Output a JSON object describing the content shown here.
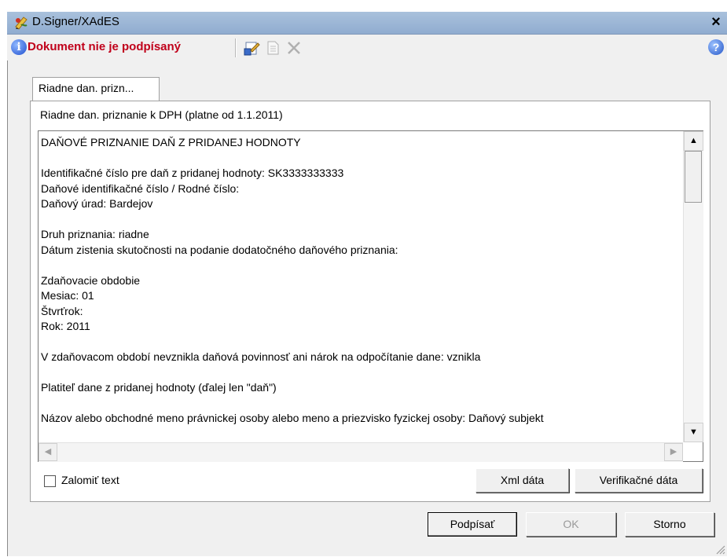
{
  "window": {
    "title": "D.Signer/XAdES",
    "close_label": "×"
  },
  "toolbar": {
    "status_text": "Dokument nie je podpísaný",
    "icons": [
      "info-icon",
      "sign-document-icon",
      "document-icon",
      "delete-icon",
      "help-icon"
    ]
  },
  "tab": {
    "label": "Riadne dan. prizn..."
  },
  "document": {
    "title": "Riadne dan. priznanie k DPH (platne od 1.1.2011)",
    "lines": [
      "DAŇOVÉ PRIZNANIE DAŇ Z PRIDANEJ HODNOTY",
      "",
      "Identifikačné číslo pre daň z pridanej hodnoty: SK3333333333",
      "Daňové identifikačné číslo / Rodné číslo:",
      "Daňový úrad: Bardejov",
      "",
      "Druh priznania: riadne",
      "Dátum zistenia skutočnosti na podanie dodatočného daňového priznania:",
      "",
      "Zdaňovacie obdobie",
      "Mesiac: 01",
      "Štvrťrok:",
      "Rok: 2011",
      "",
      "V zdaňovacom období nevznikla daňová povinnosť ani nárok na odpočítanie dane: vznikla",
      "",
      "Platiteľ dane z pridanej hodnoty (ďalej len \"daň\")",
      "",
      "Názov alebo obchodné meno právnickej osoby alebo meno a priezvisko fyzickej osoby: Daňový subjekt"
    ]
  },
  "controls": {
    "wrap_text_label": "Zalomiť text",
    "wrap_text_checked": false,
    "xml_button": "Xml dáta",
    "verification_button": "Verifikačné dáta",
    "sign_button": "Podpísať",
    "ok_button": "OK",
    "cancel_button": "Storno"
  },
  "colors": {
    "status": "#c0001a",
    "titlebar": "#a9c1dc"
  }
}
